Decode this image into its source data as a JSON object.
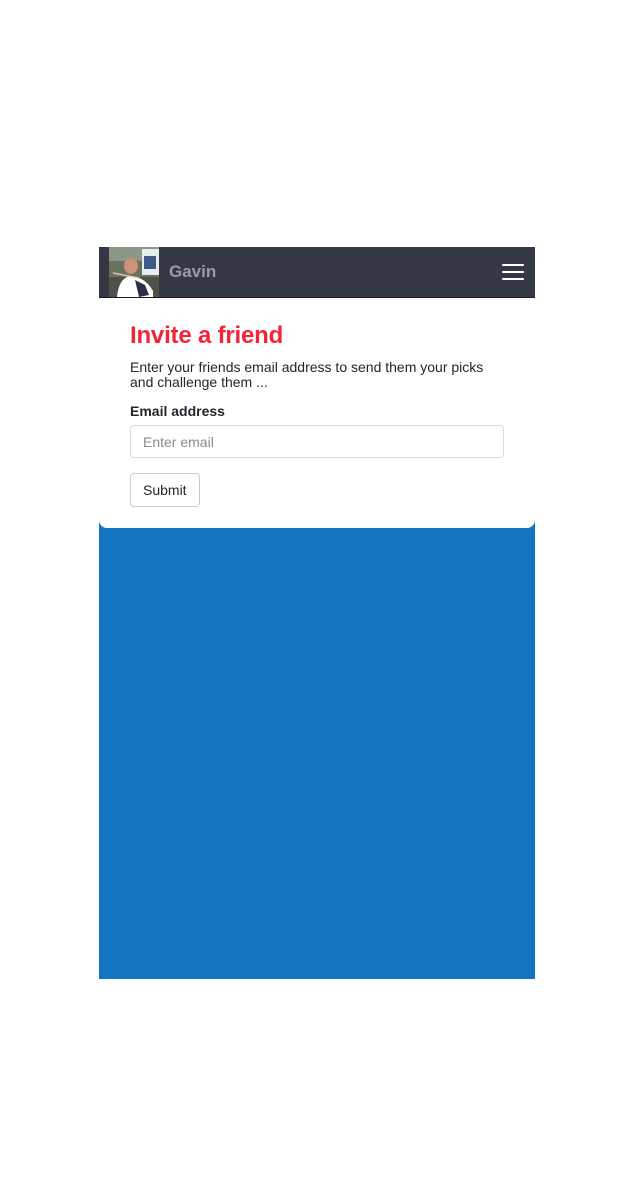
{
  "navbar": {
    "brand": "Gavin",
    "avatar_icon": "user-photo-icon",
    "menu_icon": "hamburger-menu-icon",
    "background": "#343744"
  },
  "card": {
    "title": "Invite a friend",
    "description": "Enter your friends email address to send them your picks and challenge them ...",
    "email_label": "Email address",
    "email_placeholder": "Enter email",
    "email_value": "",
    "submit_label": "Submit"
  },
  "colors": {
    "title_red": "#f42437",
    "page_blue": "#1574c2",
    "navbar_dark": "#343744"
  }
}
